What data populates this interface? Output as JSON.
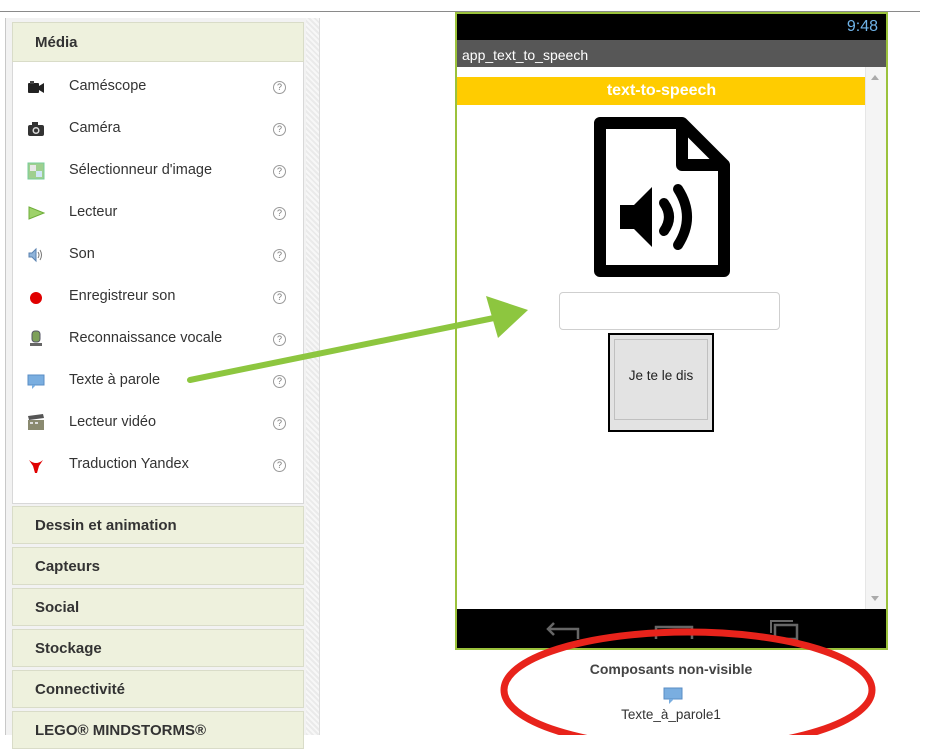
{
  "palette": {
    "section_title": "Média",
    "items": [
      {
        "label": "Caméscope",
        "icon": "camcorder-icon",
        "help": "?"
      },
      {
        "label": "Caméra",
        "icon": "camera-icon",
        "help": "?"
      },
      {
        "label": "Sélectionneur d'image",
        "icon": "image-picker-icon",
        "help": "?"
      },
      {
        "label": "Lecteur",
        "icon": "player-icon",
        "help": "?"
      },
      {
        "label": "Son",
        "icon": "sound-icon",
        "help": "?"
      },
      {
        "label": "Enregistreur son",
        "icon": "sound-recorder-icon",
        "help": "?"
      },
      {
        "label": "Reconnaissance vocale",
        "icon": "speech-recognizer-icon",
        "help": "?"
      },
      {
        "label": "Texte à parole",
        "icon": "text-to-speech-icon",
        "help": "?"
      },
      {
        "label": "Lecteur vidéo",
        "icon": "video-player-icon",
        "help": "?"
      },
      {
        "label": "Traduction Yandex",
        "icon": "yandex-translate-icon",
        "help": "?"
      }
    ],
    "categories": [
      {
        "label": "Dessin et animation"
      },
      {
        "label": "Capteurs"
      },
      {
        "label": "Social"
      },
      {
        "label": "Stockage"
      },
      {
        "label": "Connectivité"
      },
      {
        "label": "LEGO® MINDSTORMS®"
      }
    ]
  },
  "phone": {
    "clock": "9:48",
    "app_title": "app_text_to_speech",
    "banner": "text-to-speech",
    "button_label": "Je te le dis"
  },
  "nonvisible": {
    "title": "Composants non-visible",
    "component": "Texte_à_parole1"
  },
  "colors": {
    "accent_green": "#8dc63f",
    "banner_yellow": "#ffcc00",
    "annotation_red": "#e8231b",
    "phone_border": "#9bc23c"
  }
}
